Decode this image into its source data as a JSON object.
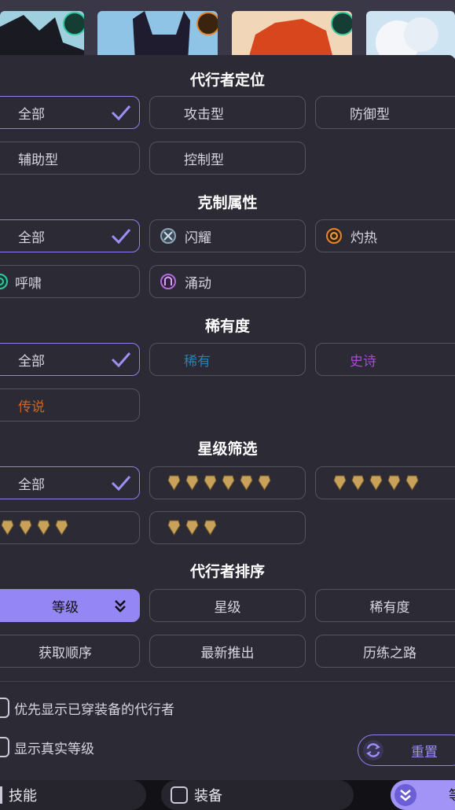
{
  "sections": {
    "role": {
      "title": "代行者定位",
      "options": [
        "全部",
        "攻击型",
        "防御型",
        "辅助型",
        "控制型"
      ]
    },
    "element": {
      "title": "克制属性",
      "options": [
        "全部",
        "闪耀",
        "灼热",
        "呼啸",
        "涌动"
      ]
    },
    "rarity": {
      "title": "稀有度",
      "options": [
        "全部",
        "稀有",
        "史诗",
        "传说"
      ],
      "colors": {
        "rare": "#2b7fae",
        "epic": "#a44bd0",
        "legend": "#c9652c"
      }
    },
    "stars": {
      "title": "星级筛选",
      "all_label": "全部",
      "star_counts": [
        6,
        5,
        4,
        3
      ]
    },
    "sort": {
      "title": "代行者排序",
      "options": [
        "等级",
        "星级",
        "稀有度",
        "获取顺序",
        "最新推出",
        "历练之路"
      ]
    }
  },
  "checkboxes": {
    "equipped_first": "优先显示已穿装备的代行者",
    "real_level": "显示真实等级"
  },
  "reset_label": "重置",
  "bottom_bar": {
    "skills_label": "技能",
    "equipment_label": "装备",
    "sort_label": "等"
  },
  "colors": {
    "accent": "#9486f5",
    "panel_bg": "#2c2a35",
    "star": "#c8a15a"
  },
  "icons": [
    "check-icon",
    "double-chevron-down-icon",
    "refresh-icon",
    "shine-element-icon",
    "heat-element-icon",
    "howl-element-icon",
    "surge-element-icon",
    "star-icon"
  ]
}
